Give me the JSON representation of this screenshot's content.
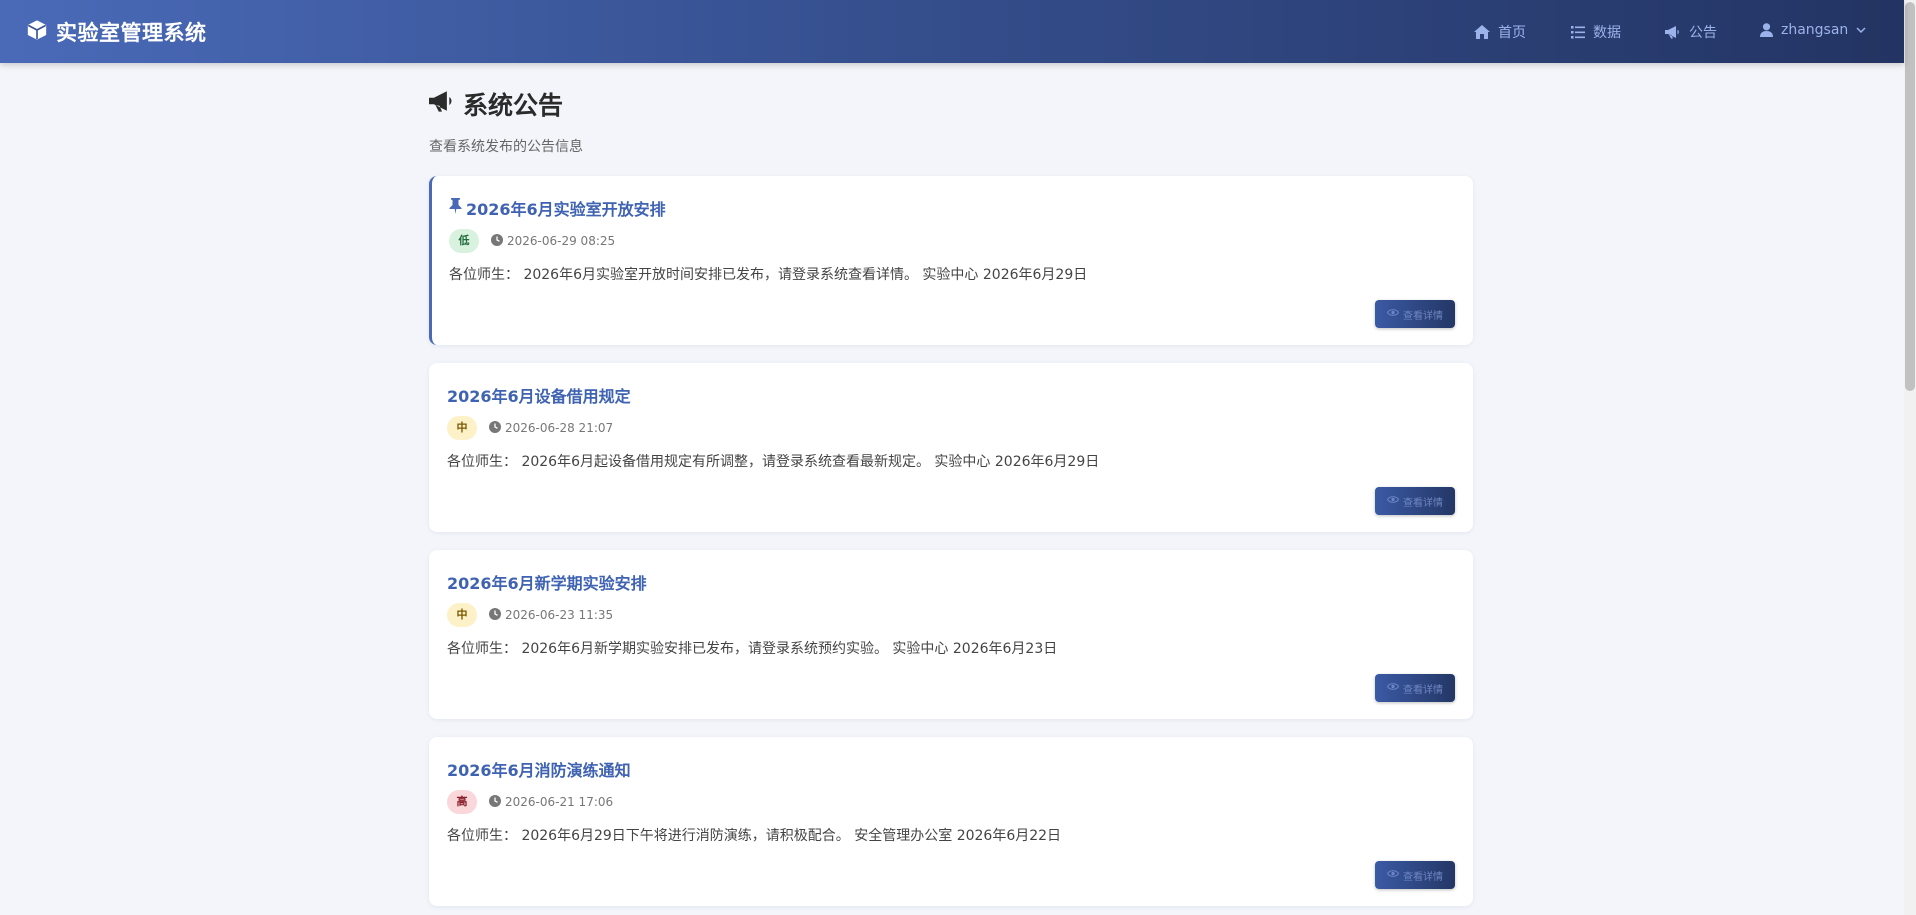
{
  "navbar": {
    "brand": "实验室管理系统",
    "items": [
      {
        "label": "首页",
        "icon": "home-icon"
      },
      {
        "label": "数据",
        "icon": "list-icon"
      },
      {
        "label": "公告",
        "icon": "megaphone-icon"
      }
    ],
    "user": {
      "name": "zhangsan",
      "icon": "user-icon"
    }
  },
  "page": {
    "title": "系统公告",
    "subtitle": "查看系统发布的公告信息"
  },
  "announcements": [
    {
      "pinned": true,
      "title": "2026年6月实验室开放安排",
      "priority": "低",
      "date": "2026-06-29 08:25",
      "body": "各位师生： 2026年6月实验室开放时间安排已发布，请登录系统查看详情。 实验中心 2026年6月29日",
      "button": "查看详情"
    },
    {
      "pinned": false,
      "title": "2026年6月设备借用规定",
      "priority": "中",
      "date": "2026-06-28 21:07",
      "body": "各位师生： 2026年6月起设备借用规定有所调整，请登录系统查看最新规定。 实验中心 2026年6月29日",
      "button": "查看详情"
    },
    {
      "pinned": false,
      "title": "2026年6月新学期实验安排",
      "priority": "中",
      "date": "2026-06-23 11:35",
      "body": "各位师生： 2026年6月新学期实验安排已发布，请登录系统预约实验。 实验中心 2026年6月23日",
      "button": "查看详情"
    },
    {
      "pinned": false,
      "title": "2026年6月消防演练通知",
      "priority": "高",
      "date": "2026-06-21 17:06",
      "body": "各位师生： 2026年6月29日下午将进行消防演练，请积极配合。 安全管理办公室 2026年6月22日",
      "button": "查看详情"
    }
  ]
}
